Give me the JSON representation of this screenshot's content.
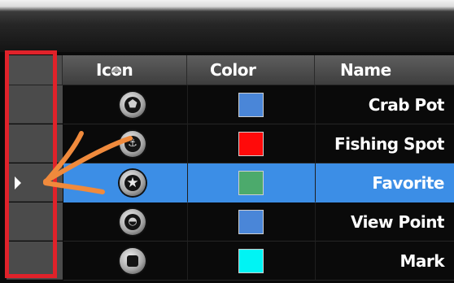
{
  "header": {
    "icon_label": "Icon",
    "color_label": "Color",
    "name_label": "Name"
  },
  "rows": [
    {
      "icon": "crab-pot-icon",
      "glyph": "⬟",
      "color": "#4a86d8",
      "name": "Crab Pot",
      "selected": false
    },
    {
      "icon": "fishing-spot-icon",
      "glyph": "⚓",
      "color": "#ff0a0a",
      "name": "Fishing Spot",
      "selected": false
    },
    {
      "icon": "star-icon",
      "glyph": "★",
      "color": "#4caa6c",
      "name": "Favorite",
      "selected": true
    },
    {
      "icon": "view-point-icon",
      "glyph": "◓",
      "color": "#4a86d8",
      "name": "View Point",
      "selected": false
    },
    {
      "icon": "mark-icon",
      "glyph": "■",
      "color": "#00f4f4",
      "name": "Mark",
      "selected": false
    }
  ],
  "colors": {
    "selection": "#3c8ee6",
    "highlight_border": "#e0222a",
    "annotation_arrow": "#f08a3c"
  }
}
